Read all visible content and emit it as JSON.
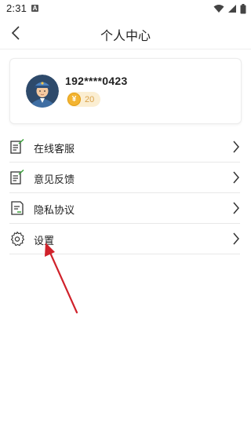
{
  "status_bar": {
    "time": "2:31",
    "notification_icon": "a-icon",
    "right_icons": [
      "wifi-icon",
      "signal-icon",
      "battery-icon"
    ]
  },
  "nav": {
    "title": "个人中心",
    "back_icon": "chevron-left-icon"
  },
  "profile": {
    "username": "192****0423",
    "coin_symbol": "¥",
    "coin_count": "20",
    "avatar_icon": "avatar-conductor-icon"
  },
  "menu": {
    "items": [
      {
        "label": "在线客服",
        "icon": "note-edit-icon"
      },
      {
        "label": "意见反馈",
        "icon": "note-edit-icon"
      },
      {
        "label": "隐私协议",
        "icon": "document-icon"
      },
      {
        "label": "设置",
        "icon": "gear-icon"
      }
    ]
  },
  "colors": {
    "coin_bg": "#fbeed2",
    "coin_fg": "#f3b431",
    "annotation_arrow": "#d0222b",
    "icon_green": "#3aa33a"
  }
}
